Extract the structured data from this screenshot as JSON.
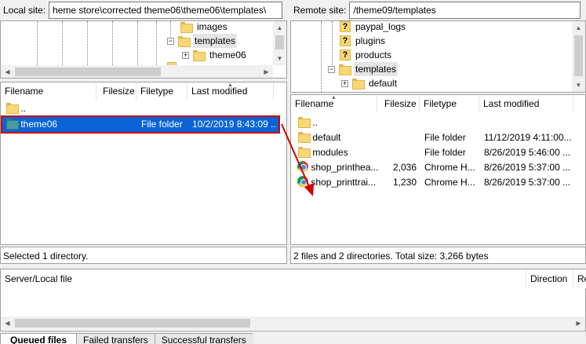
{
  "local": {
    "site_label": "Local site:",
    "site_path": "heme store\\corrected theme06\\theme06\\templates\\",
    "tree": [
      {
        "label": "images",
        "icon": "folder-icon",
        "selected": false
      },
      {
        "label": "templates",
        "icon": "folder-icon",
        "selected": true
      },
      {
        "label": "theme06",
        "icon": "folder-icon",
        "selected": false
      }
    ],
    "columns": [
      "Filename",
      "Filesize",
      "Filetype",
      "Last modified"
    ],
    "rows": [
      {
        "name": "..",
        "size": "",
        "type": "",
        "modified": "",
        "icon": "folder-icon"
      },
      {
        "name": "theme06",
        "size": "",
        "type": "File folder",
        "modified": "10/2/2019 8:43:09 ...",
        "icon": "folder-icon",
        "highlight": true
      }
    ],
    "status": "Selected 1 directory."
  },
  "remote": {
    "site_label": "Remote site:",
    "site_path": "/theme09/templates",
    "tree": [
      {
        "label": "paypal_logs",
        "icon": "unknown-icon",
        "selected": false
      },
      {
        "label": "plugins",
        "icon": "unknown-icon",
        "selected": false
      },
      {
        "label": "products",
        "icon": "unknown-icon",
        "selected": false
      },
      {
        "label": "templates",
        "icon": "folder-icon",
        "selected": true
      },
      {
        "label": "default",
        "icon": "folder-icon",
        "selected": false
      }
    ],
    "columns": [
      "Filename",
      "Filesize",
      "Filetype",
      "Last modified"
    ],
    "rows": [
      {
        "name": "..",
        "size": "",
        "type": "",
        "modified": "",
        "icon": "folder-icon"
      },
      {
        "name": "default",
        "size": "",
        "type": "File folder",
        "modified": "11/12/2019 4:11:00...",
        "icon": "folder-icon"
      },
      {
        "name": "modules",
        "size": "",
        "type": "File folder",
        "modified": "8/26/2019 5:46:00 ...",
        "icon": "folder-icon"
      },
      {
        "name": "shop_printhea...",
        "size": "2,036",
        "type": "Chrome H...",
        "modified": "8/26/2019 5:37:00 ...",
        "icon": "chrome-icon"
      },
      {
        "name": "shop_printtrai...",
        "size": "1,230",
        "type": "Chrome H...",
        "modified": "8/26/2019 5:37:00 ...",
        "icon": "chrome-icon"
      }
    ],
    "status": "2 files and 2 directories. Total size: 3,266 bytes"
  },
  "queue": {
    "columns": [
      "Server/Local file",
      "Direction",
      "Re"
    ],
    "tabs": [
      "Queued files",
      "Failed transfers",
      "Successful transfers"
    ]
  },
  "colors": {
    "selection": "#0a64d7",
    "annotation": "#d00000"
  }
}
